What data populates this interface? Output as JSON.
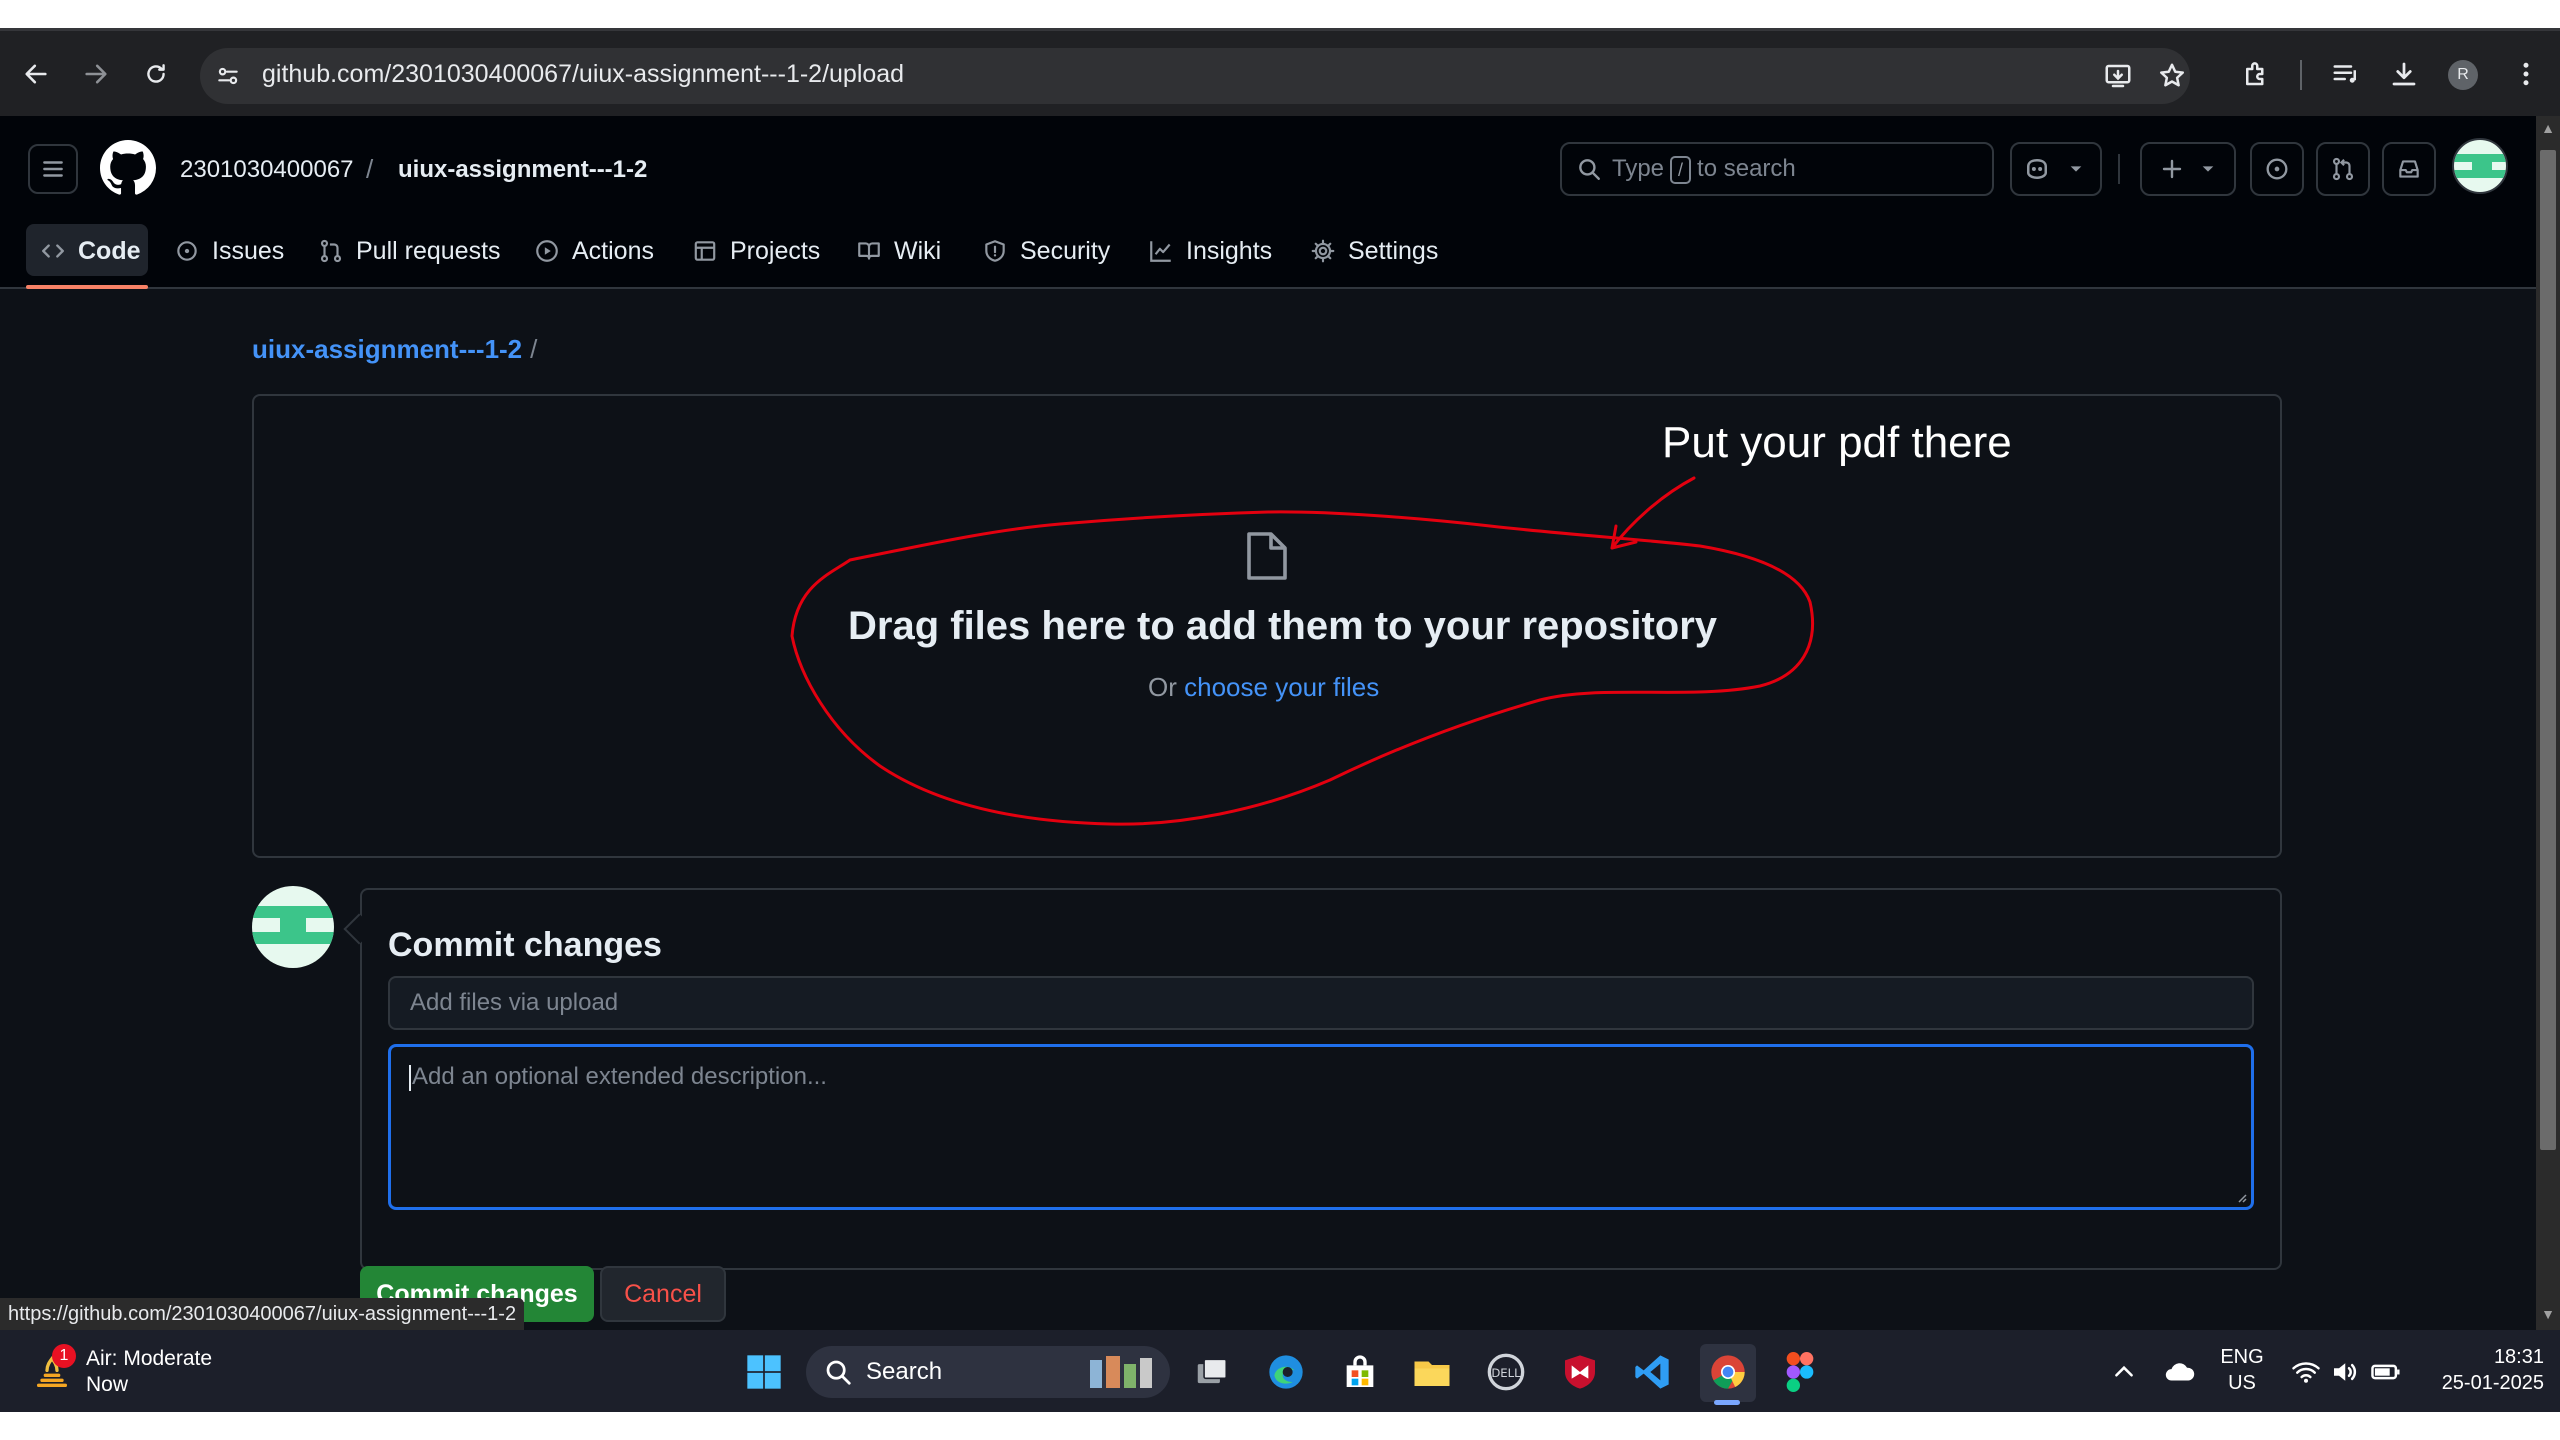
{
  "browser": {
    "url": "github.com/2301030400067/uiux-assignment---1-2/upload",
    "profile_initial": "R",
    "status_url": "https://github.com/2301030400067/uiux-assignment---1-2"
  },
  "header": {
    "owner": "2301030400067",
    "separator": "/",
    "repo": "uiux-assignment---1-2",
    "search_prefix": "Type",
    "search_key": "/",
    "search_suffix": "to search"
  },
  "tabs": [
    {
      "label": "Code",
      "icon": "code-icon",
      "active": true
    },
    {
      "label": "Issues",
      "icon": "issue-icon"
    },
    {
      "label": "Pull requests",
      "icon": "pull-request-icon"
    },
    {
      "label": "Actions",
      "icon": "play-icon"
    },
    {
      "label": "Projects",
      "icon": "table-icon"
    },
    {
      "label": "Wiki",
      "icon": "book-icon"
    },
    {
      "label": "Security",
      "icon": "shield-icon"
    },
    {
      "label": "Insights",
      "icon": "graph-icon"
    },
    {
      "label": "Settings",
      "icon": "gear-icon"
    }
  ],
  "breadcrumb": {
    "repo": "uiux-assignment---1-2",
    "separator": "/"
  },
  "dropzone": {
    "title": "Drag files here to add them to your repository",
    "sub_prefix": "Or",
    "sub_link": "choose your files"
  },
  "annotation": {
    "text": "Put your pdf there",
    "color": "#e3000f"
  },
  "commit": {
    "title": "Commit changes",
    "summary_placeholder": "Add files via upload",
    "description_placeholder": "Add an optional extended description...",
    "submit_label": "Commit changes",
    "cancel_label": "Cancel"
  },
  "taskbar": {
    "weather_title": "Air: Moderate",
    "weather_sub": "Now",
    "weather_badge": "1",
    "search_label": "Search",
    "language_top": "ENG",
    "language_bottom": "US",
    "time": "18:31",
    "date": "25-01-2025"
  },
  "colors": {
    "accent_link": "#4493f8",
    "primary_button": "#238636",
    "danger_text": "#f85149",
    "tab_underline": "#f78166",
    "page_bg": "#0d1117"
  }
}
